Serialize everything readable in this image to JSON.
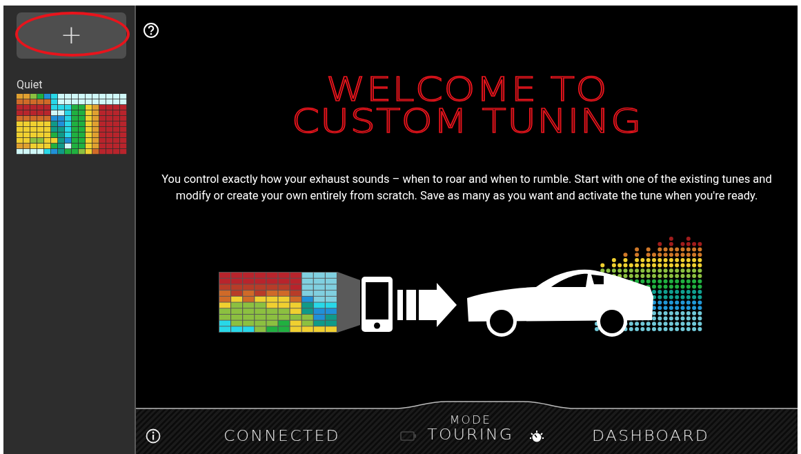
{
  "sidebar": {
    "add_button": {
      "label": "+"
    },
    "tunes": [
      {
        "name": "Quiet"
      }
    ]
  },
  "main": {
    "title_lines": [
      "WELCOME TO",
      "CUSTOM TUNING"
    ],
    "description": "You control exactly how your exhaust sounds – when to roar and when to rumble. Start with one of the existing tunes and modify or create your own entirely from scratch. Save as many as you want and activate the tune when you're ready."
  },
  "status_bar": {
    "connection": "CONNECTED",
    "mode_label": "MODE",
    "mode": "TOURING",
    "dashboard": "DASHBOARD"
  }
}
